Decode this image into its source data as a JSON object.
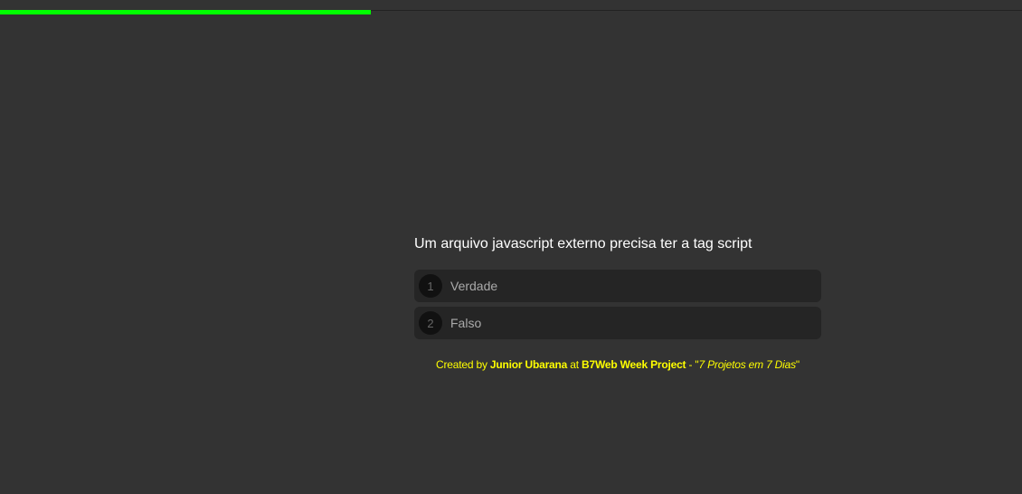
{
  "progress": {
    "value_percent": 36.3,
    "color": "#00ff00"
  },
  "quiz": {
    "question": "Um arquivo javascript externo precisa ter a tag script",
    "options": [
      {
        "number": "1",
        "label": "Verdade"
      },
      {
        "number": "2",
        "label": "Falso"
      }
    ]
  },
  "footer": {
    "created_by": "Created by",
    "author": "Junior Ubarana",
    "at": "at",
    "project": "B7Web Week Project",
    "dash": "- \"",
    "tagline": "7 Projetos em 7 Dias",
    "close_quote": "\""
  },
  "colors": {
    "background": "#333333",
    "accent_footer": "#ffff00"
  }
}
